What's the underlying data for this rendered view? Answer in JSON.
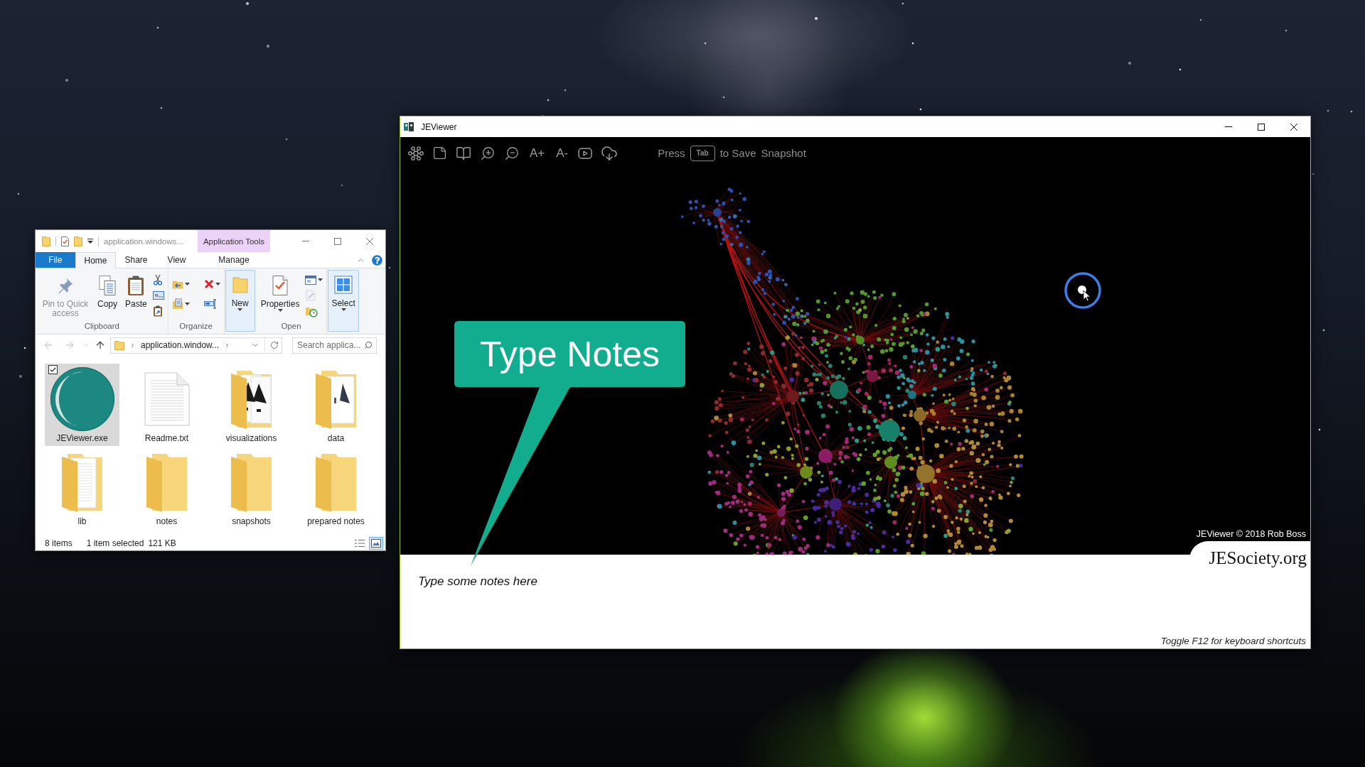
{
  "explorer": {
    "quick_access": [
      {
        "kind": "folder"
      },
      {
        "kind": "properties"
      },
      {
        "kind": "folder"
      },
      {
        "kind": "customize"
      }
    ],
    "title": "application.windows...",
    "context_tab_group": "Application Tools",
    "tabs": [
      {
        "label": "File",
        "kind": "file",
        "selected": false
      },
      {
        "label": "Home",
        "kind": "tab",
        "selected": true
      },
      {
        "label": "Share",
        "kind": "tab",
        "selected": false
      },
      {
        "label": "View",
        "kind": "tab",
        "selected": false
      },
      {
        "label": "Manage",
        "kind": "context",
        "selected": false
      }
    ],
    "groups": [
      {
        "kind": "group",
        "label": "Clipboard",
        "buttons": [
          {
            "kind": "pin",
            "label": "Pin to Quick access",
            "disabled": true,
            "dropdown": false
          },
          {
            "kind": "copy",
            "label": "Copy",
            "disabled": false,
            "dropdown": false
          },
          {
            "kind": "paste",
            "label": "Paste",
            "disabled": false,
            "dropdown": false
          },
          {
            "kind": "cut",
            "disabled": false,
            "dropdown": false
          },
          {
            "kind": "copy-path",
            "disabled": false,
            "dropdown": false
          },
          {
            "kind": "paste-shortcut",
            "disabled": false,
            "dropdown": false
          }
        ]
      },
      {
        "kind": "group",
        "label": "Organize",
        "buttons": [
          {
            "kind": "move-to",
            "disabled": false,
            "dropdown": true
          },
          {
            "kind": "copy-to",
            "disabled": false,
            "dropdown": true
          },
          {
            "kind": "delete",
            "disabled": false,
            "dropdown": true
          },
          {
            "kind": "rename",
            "disabled": false,
            "dropdown": false
          }
        ]
      },
      {
        "kind": "collapsed",
        "buttons": [
          {
            "kind": "new",
            "label": "New",
            "disabled": false,
            "dropdown": true
          }
        ]
      },
      {
        "kind": "group",
        "label": "Open",
        "buttons": [
          {
            "kind": "properties",
            "label": "Properties",
            "disabled": false,
            "dropdown": true
          },
          {
            "kind": "open",
            "disabled": false,
            "dropdown": true
          },
          {
            "kind": "edit",
            "disabled": true,
            "dropdown": false
          },
          {
            "kind": "history",
            "disabled": false,
            "dropdown": false
          }
        ]
      },
      {
        "kind": "collapsed",
        "buttons": [
          {
            "kind": "select",
            "label": "Select",
            "disabled": false,
            "dropdown": true
          }
        ]
      }
    ],
    "nav": [
      {
        "kind": "back",
        "disabled": true
      },
      {
        "kind": "forward",
        "disabled": true
      },
      {
        "kind": "recent",
        "disabled": true
      },
      {
        "kind": "up",
        "disabled": false
      }
    ],
    "address": {
      "crumbs": [
        "application.window..."
      ]
    },
    "search": {
      "placeholder": "Search applica..."
    },
    "items": [
      {
        "name": "JEViewer.exe",
        "kind": "app",
        "selected": true
      },
      {
        "name": "Readme.txt",
        "kind": "text",
        "selected": false
      },
      {
        "name": "visualizations",
        "kind": "folder-pictures",
        "selected": false
      },
      {
        "name": "data",
        "kind": "folder-picture",
        "selected": false
      },
      {
        "name": "lib",
        "kind": "folder-files",
        "selected": false
      },
      {
        "name": "notes",
        "kind": "folder",
        "selected": false
      },
      {
        "name": "snapshots",
        "kind": "folder",
        "selected": false
      },
      {
        "name": "prepared notes",
        "kind": "folder",
        "selected": false
      }
    ],
    "status": {
      "count": "8 items",
      "selection": "1 item selected",
      "size": "121 KB"
    },
    "views": [
      {
        "kind": "details",
        "selected": false
      },
      {
        "kind": "large-icons",
        "selected": true
      }
    ]
  },
  "viewer": {
    "title": "JEViewer",
    "toolbar": [
      {
        "kind": "graph"
      },
      {
        "kind": "note"
      },
      {
        "kind": "book"
      },
      {
        "kind": "zoom-in"
      },
      {
        "kind": "zoom-out"
      },
      {
        "kind": "text",
        "label": "A+"
      },
      {
        "kind": "text",
        "label": "A-"
      },
      {
        "kind": "play"
      },
      {
        "kind": "cloud-download"
      }
    ],
    "hint": [
      {
        "kind": "text",
        "text": "Press"
      },
      {
        "kind": "key",
        "text": "Tab"
      },
      {
        "kind": "text",
        "text": "to Save"
      },
      {
        "kind": "text",
        "text": "Snapshot"
      }
    ],
    "callout": "Type Notes",
    "copyright": "JEViewer © 2018 Rob Boss",
    "logo": "JESociety.org",
    "notes": {
      "placeholder": "Type some notes here"
    },
    "shortcut_hint": "Toggle F12 for keyboard shortcuts"
  }
}
